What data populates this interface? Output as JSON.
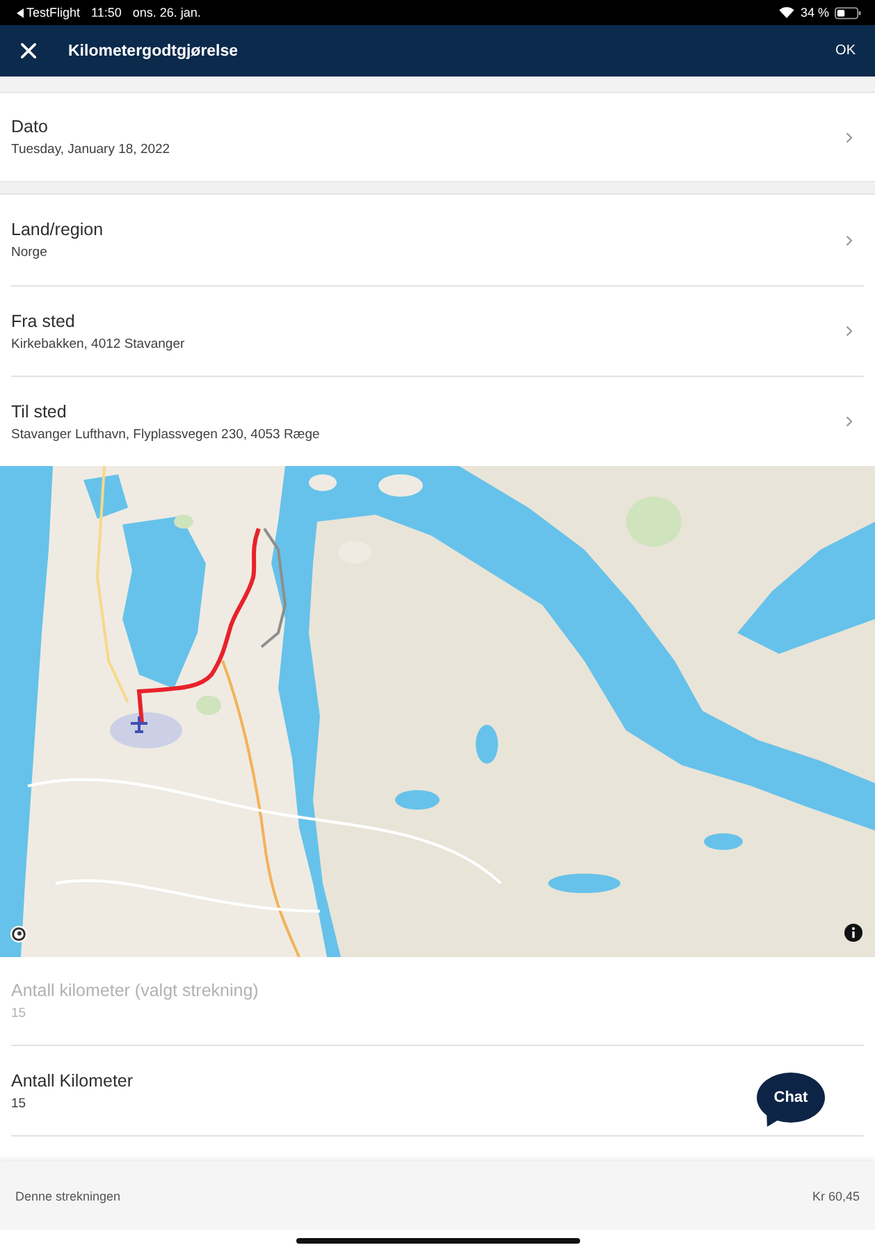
{
  "status_bar": {
    "back_app": "TestFlight",
    "time": "11:50",
    "date": "ons. 26. jan.",
    "battery": "34 %"
  },
  "header": {
    "title": "Kilometergodtgjørelse",
    "action": "OK"
  },
  "date_section": [
    {
      "kind": "link",
      "label": "Dato",
      "value": "Tuesday, January 18, 2022",
      "disabled": false
    }
  ],
  "route_section": [
    {
      "kind": "link",
      "label": "Land/region",
      "value": "Norge",
      "disabled": false
    },
    {
      "kind": "link",
      "label": "Fra sted",
      "value": "Kirkebakken, 4012 Stavanger",
      "disabled": false
    },
    {
      "kind": "link",
      "label": "Til sted",
      "value": "Stavanger Lufthavn, Flyplassvegen 230, 4053 Ræge",
      "disabled": false
    }
  ],
  "distance_section": [
    {
      "kind": "value",
      "label": "Antall kilometer (valgt strekning)",
      "value": "15",
      "disabled": true
    },
    {
      "kind": "value",
      "label": "Antall Kilometer",
      "value": "15",
      "disabled": false
    }
  ],
  "chat_button": {
    "label": "Chat"
  },
  "footer": {
    "label": "Denne strekningen",
    "amount": "Kr 60,45"
  }
}
